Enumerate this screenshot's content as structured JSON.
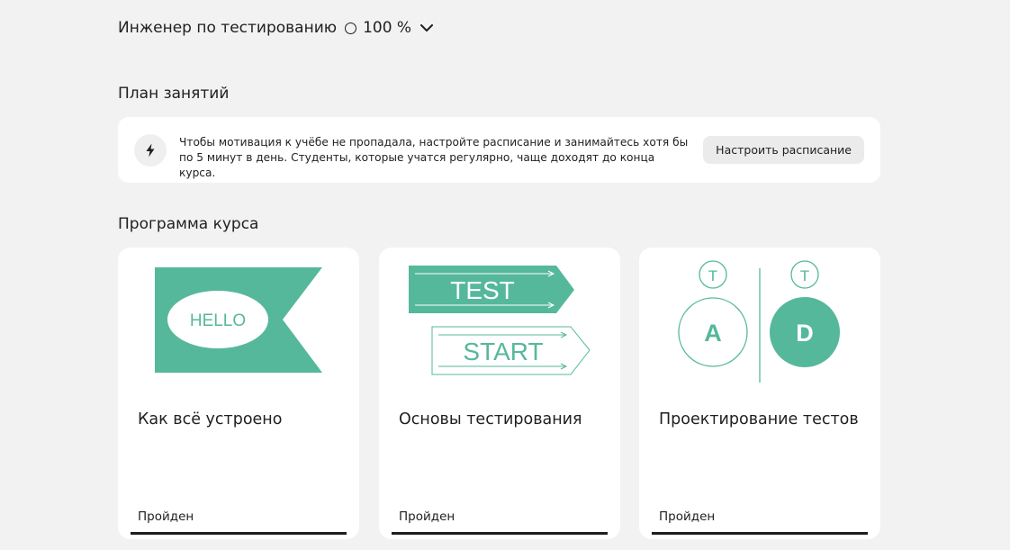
{
  "header": {
    "course_name": "Инженер по тестированию",
    "progress_label": "100 %",
    "progress": 1.0
  },
  "plan": {
    "title": "План занятий",
    "tip_text": "Чтобы мотивация к учёбе не пропадала, настройте расписание и занимайтесь хотя бы по 5 минут в день. Студенты, которые учатся регулярно, чаще доходят до конца курса.",
    "button_label": "Настроить расписание"
  },
  "program": {
    "title": "Программа курса",
    "cards": [
      {
        "title": "Как всё устроено",
        "status": "Пройден",
        "progress": 1.0,
        "art_text": [
          "HELLO"
        ]
      },
      {
        "title": "Основы тестирования",
        "status": "Пройден",
        "progress": 1.0,
        "art_text": [
          "TEST",
          "START"
        ]
      },
      {
        "title": "Проектирование тестов",
        "status": "Пройден",
        "progress": 1.0,
        "art_text": [
          "T",
          "T",
          "A",
          "D"
        ]
      }
    ]
  },
  "colors": {
    "accent": "#56b89b",
    "background": "#f2f2f2",
    "card": "#ffffff",
    "text": "#1f1f1f"
  },
  "icons": [
    "progress-ring-icon",
    "chevron-down-icon",
    "lightning-icon"
  ]
}
